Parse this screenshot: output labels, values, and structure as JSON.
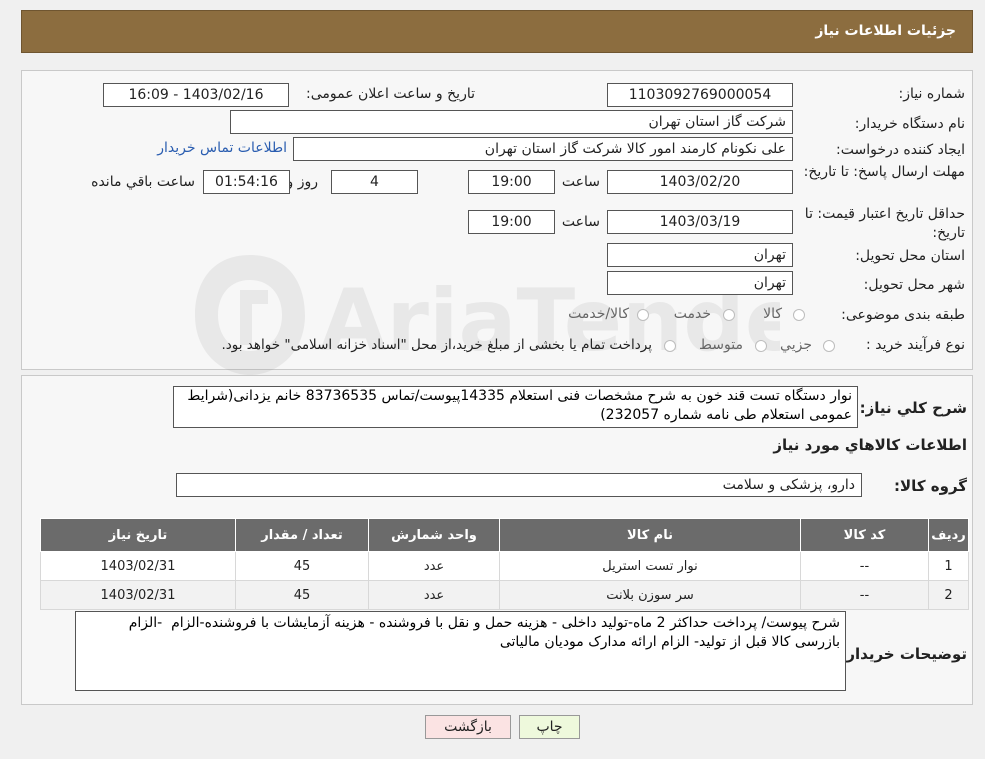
{
  "header": {
    "title": "جزئیات اطلاعات نیاز"
  },
  "watermark": {
    "text": "AriaTender.neT"
  },
  "fields": {
    "need_number_label": "شماره نیاز:",
    "need_number": "1103092769000054",
    "announce_label": "تاریخ و ساعت اعلان عمومی:",
    "announce_value": "1403/02/16 - 16:09",
    "buyer_org_label": "نام دستگاه خریدار:",
    "buyer_org": "شرکت گاز استان تهران",
    "creator_label": "ایجاد کننده درخواست:",
    "creator": "علی نکونام کارمند امور کالا شرکت گاز استان تهران",
    "contact_link": "اطلاعات تماس خریدار",
    "reply_deadline_label": "مهلت ارسال پاسخ: تا تاریخ:",
    "reply_date": "1403/02/20",
    "time_label": "ساعت",
    "reply_time": "19:00",
    "days_value": "4",
    "days_label": "روز و",
    "remaining_time": "01:54:16",
    "remaining_label": "ساعت باقي مانده",
    "validity_label": "حداقل تاریخ اعتبار قیمت: تا تاریخ:",
    "validity_date": "1403/03/19",
    "validity_time": "19:00",
    "province_label": "استان محل تحویل:",
    "province": "تهران",
    "city_label": "شهر محل تحویل:",
    "city": "تهران",
    "category_label": "طبقه بندی موضوعی:",
    "category_options": [
      "کالا",
      "خدمت",
      "کالا/خدمت"
    ],
    "process_label": "نوع فرآیند خرید :",
    "process_options": [
      "جزیي",
      "متوسط"
    ],
    "process_note": "پرداخت تمام یا بخشی از مبلغ خرید،از محل \"اسناد خزانه اسلامی\" خواهد بود."
  },
  "details": {
    "summary_label": "شرح کلي نياز:",
    "summary": "نوار دستگاه تست قند خون به شرح مشخصات فنی استعلام 14335پیوست/تماس 83736535 خانم یزدانی(شرایط عمومی استعلام طی نامه شماره 232057)",
    "items_title": "اطلاعات کالاهاي مورد نياز",
    "group_label": "گروه کالا:",
    "group_value": "دارو، پزشکی و سلامت",
    "table_headers": [
      "ردیف",
      "کد کالا",
      "نام کالا",
      "واحد شمارش",
      "تعداد / مقدار",
      "تاریخ نیاز"
    ],
    "rows": [
      [
        "1",
        "--",
        "نوار تست استریل",
        "عدد",
        "45",
        "1403/02/31"
      ],
      [
        "2",
        "--",
        "سر سوزن بلانت",
        "عدد",
        "45",
        "1403/02/31"
      ]
    ],
    "buyer_notes_label": "توضیحات خریدار:",
    "buyer_notes": "شرح پیوست/ پرداخت حداکثر 2 ماه-تولید داخلی - هزینه حمل و نقل با فروشنده - هزینه آزمایشات با فروشنده-الزام  -الزام بازرسی کالا قبل از تولید- الزام ارائه مدارک مودیان مالیاتی"
  },
  "buttons": {
    "print": "چاپ",
    "back": "بازگشت"
  },
  "colors": {
    "header_bg": "#8c6d3f",
    "print_bg": "#eef9dc",
    "back_bg": "#fbe3e3",
    "table_header": "#6b6b6b",
    "link": "#2a5db0"
  }
}
